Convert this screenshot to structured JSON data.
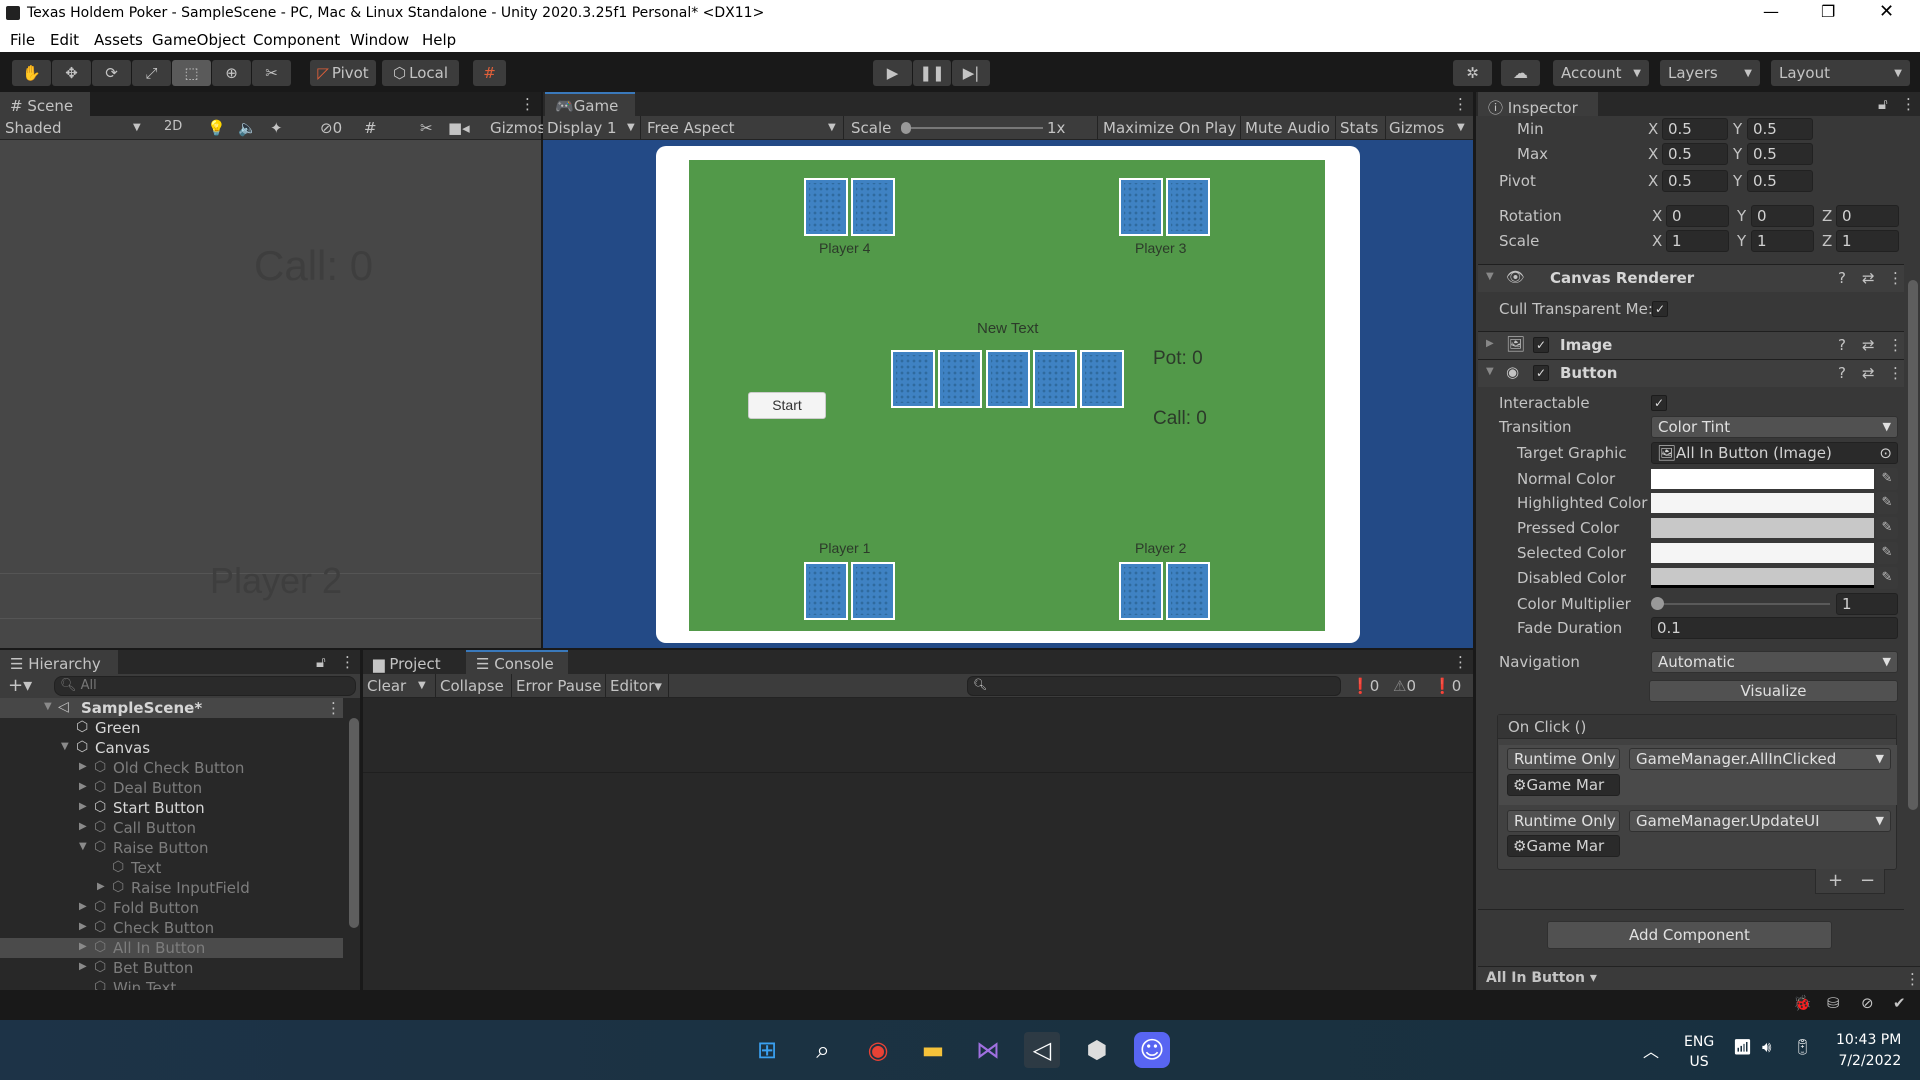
{
  "window": {
    "title": "Texas Holdem Poker - SampleScene - PC, Mac & Linux Standalone - Unity 2020.3.25f1 Personal* <DX11>"
  },
  "menu": [
    "File",
    "Edit",
    "Assets",
    "GameObject",
    "Component",
    "Window",
    "Help"
  ],
  "toolbar": {
    "pivot": "Pivot",
    "local": "Local",
    "account": "Account",
    "layers": "Layers",
    "layout": "Layout"
  },
  "scene": {
    "tab": "Scene",
    "shading": "Shaded",
    "mode_2d": "2D",
    "hidden_count": "0",
    "gizmos": "Gizmos",
    "ghost_call": "Call: 0",
    "ghost_player": "Player 2"
  },
  "game": {
    "tab": "Game",
    "display": "Display 1",
    "aspect": "Free Aspect",
    "scale_label": "Scale",
    "scale_value": "1x",
    "maximize": "Maximize On Play",
    "mute": "Mute Audio",
    "stats": "Stats",
    "gizmos": "Gizmos",
    "table_color": "#529949",
    "players": [
      "Player 1",
      "Player 2",
      "Player 3",
      "Player 4"
    ],
    "new_text": "New Text",
    "pot": "Pot: 0",
    "call": "Call: 0",
    "start_button": "Start"
  },
  "inspector": {
    "tab": "Inspector",
    "rect": {
      "min": {
        "label": "Min",
        "x": "0.5",
        "y": "0.5"
      },
      "max": {
        "label": "Max",
        "x": "0.5",
        "y": "0.5"
      },
      "pivot": {
        "label": "Pivot",
        "x": "0.5",
        "y": "0.5"
      },
      "rotation": {
        "label": "Rotation",
        "x": "0",
        "y": "0",
        "z": "0"
      },
      "scale": {
        "label": "Scale",
        "x": "1",
        "y": "1",
        "z": "1"
      }
    },
    "canvas_renderer": {
      "title": "Canvas Renderer",
      "cull_label": "Cull Transparent Me:",
      "cull": true
    },
    "image": {
      "title": "Image",
      "enabled": true
    },
    "button": {
      "title": "Button",
      "enabled": true,
      "interactable_label": "Interactable",
      "interactable": true,
      "transition_label": "Transition",
      "transition": "Color Tint",
      "target_graphic_label": "Target Graphic",
      "target_graphic": "All In Button (Image)",
      "normal_label": "Normal Color",
      "normal_color": "#ffffff",
      "highlighted_label": "Highlighted Color",
      "highlighted_color": "#f5f5f5",
      "pressed_label": "Pressed Color",
      "pressed_color": "#c8c8c8",
      "selected_label": "Selected Color",
      "selected_color": "#f5f5f5",
      "disabled_label": "Disabled Color",
      "disabled_color": "#c8c8c8",
      "multiplier_label": "Color Multiplier",
      "multiplier": "1",
      "fade_label": "Fade Duration",
      "fade": "0.1",
      "navigation_label": "Navigation",
      "navigation": "Automatic",
      "visualize": "Visualize",
      "onclick_title": "On Click ()",
      "onclick": [
        {
          "mode": "Runtime Only",
          "function": "GameManager.AllInClicked",
          "target": "Game Mar"
        },
        {
          "mode": "Runtime Only",
          "function": "GameManager.UpdateUI",
          "target": "Game Mar"
        }
      ]
    },
    "add_component": "Add Component",
    "footer_object": "All In Button"
  },
  "hierarchy": {
    "tab": "Hierarchy",
    "search_placeholder": "All",
    "scene": "SampleScene*",
    "items": [
      {
        "name": "Green",
        "active": true
      },
      {
        "name": "Canvas",
        "active": true
      },
      {
        "name": "Old Check Button",
        "active": false
      },
      {
        "name": "Deal Button",
        "active": false
      },
      {
        "name": "Start Button",
        "active": true
      },
      {
        "name": "Call Button",
        "active": false
      },
      {
        "name": "Raise Button",
        "active": false
      },
      {
        "name": "Text",
        "active": false
      },
      {
        "name": "Raise InputField",
        "active": false
      },
      {
        "name": "Fold Button",
        "active": false
      },
      {
        "name": "Check Button",
        "active": false
      },
      {
        "name": "All In Button",
        "active": false
      },
      {
        "name": "Bet Button",
        "active": false
      },
      {
        "name": "Win Text",
        "active": false
      }
    ]
  },
  "console": {
    "tabs": [
      "Project",
      "Console"
    ],
    "clear": "Clear",
    "collapse": "Collapse",
    "error_pause": "Error Pause",
    "editor": "Editor",
    "log_count": "0",
    "warning_count": "0",
    "error_count": "0"
  },
  "taskbar": {
    "lang": "ENG",
    "region": "US",
    "time": "10:43 PM",
    "date": "7/2/2022"
  }
}
